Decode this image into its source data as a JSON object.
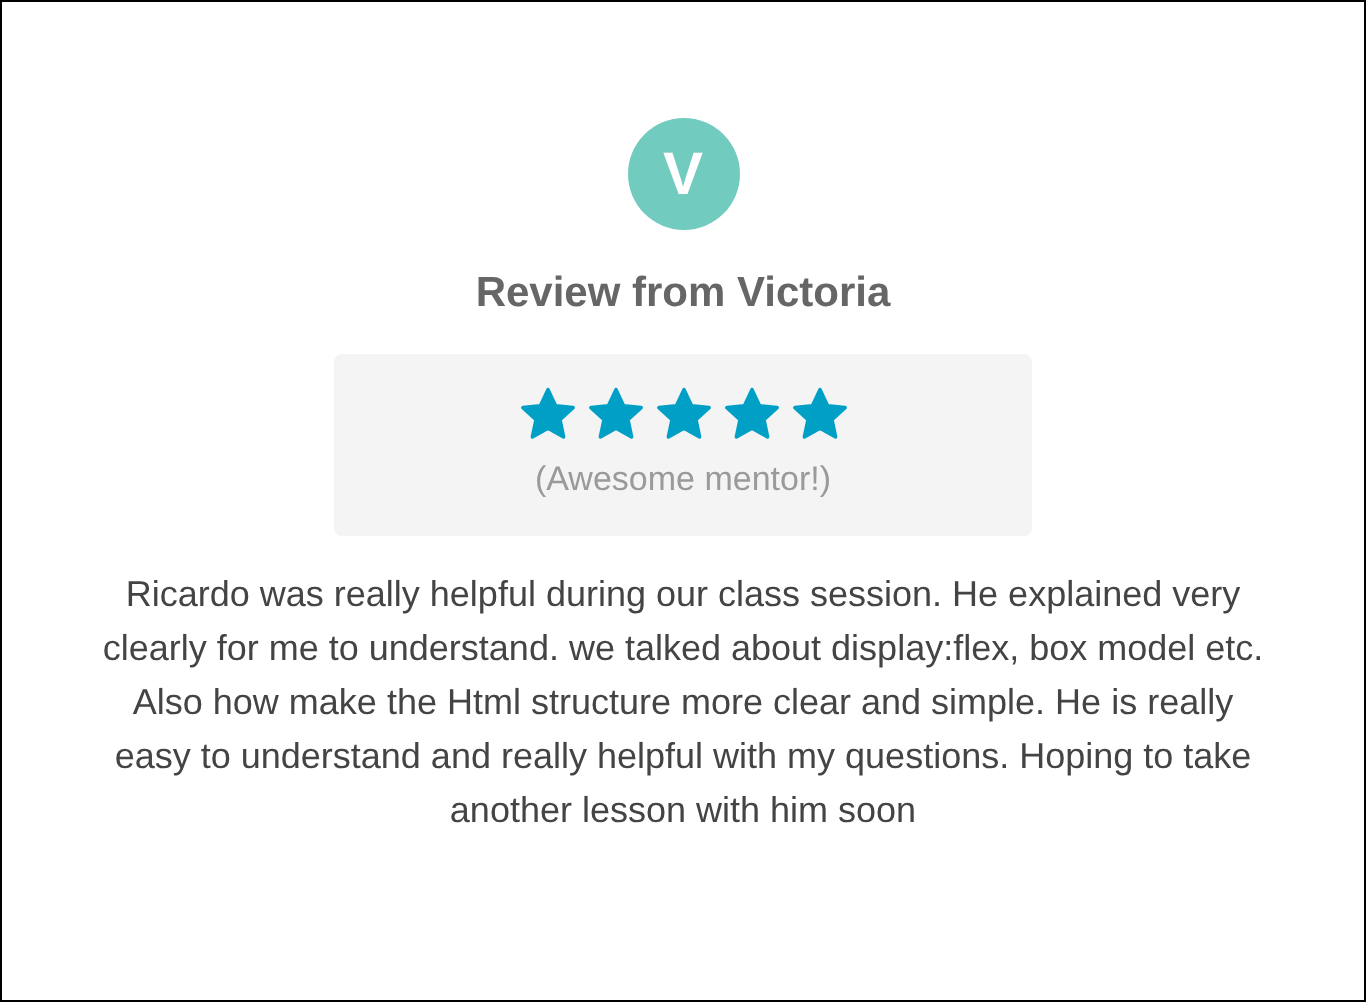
{
  "avatar": {
    "initial": "V",
    "color": "#72cbbf"
  },
  "title": "Review from Victoria",
  "rating": {
    "stars": 5,
    "caption": "(Awesome mentor!)"
  },
  "review": "Ricardo was really helpful during our class session. He explained very clearly for me to understand. we talked about display:flex, box model etc. Also how make the Html structure more clear and simple. He is really easy to understand and really helpful with my questions. Hoping to take another lesson with him soon"
}
